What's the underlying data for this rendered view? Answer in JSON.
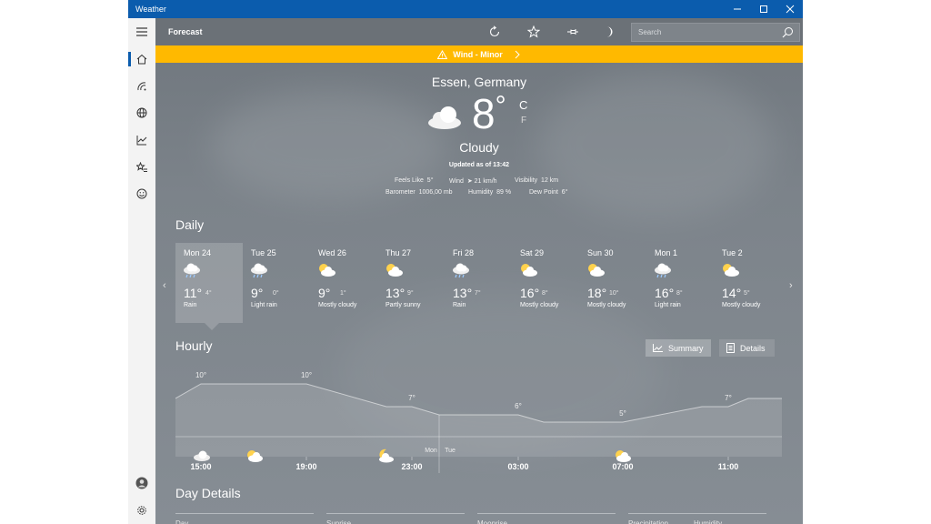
{
  "window": {
    "title": "Weather"
  },
  "appbar": {
    "title": "Forecast",
    "search_placeholder": "Search"
  },
  "alert": {
    "text": "Wind - Minor"
  },
  "current": {
    "location": "Essen, Germany",
    "temperature": "8",
    "degree": "°",
    "unit_c": "C",
    "unit_f": "F",
    "condition": "Cloudy",
    "updated": "Updated as of 13:42",
    "feels_like_label": "Feels Like",
    "feels_like": "5°",
    "wind_label": "Wind",
    "wind": "➤ 21 km/h",
    "visibility_label": "Visibility",
    "visibility": "12 km",
    "barometer_label": "Barometer",
    "barometer": "1006,00 mb",
    "humidity_label": "Humidity",
    "humidity": "89 %",
    "dewpoint_label": "Dew Point",
    "dewpoint": "6°"
  },
  "daily": {
    "title": "Daily",
    "days": [
      {
        "name": "Mon 24",
        "hi": "11°",
        "lo": "4°",
        "desc": "Rain",
        "icon": "rain-cloud-icon"
      },
      {
        "name": "Tue 25",
        "hi": "9°",
        "lo": "0°",
        "desc": "Light rain",
        "icon": "rain-cloud-icon"
      },
      {
        "name": "Wed 26",
        "hi": "9°",
        "lo": "1°",
        "desc": "Mostly cloudy",
        "icon": "partly-sunny-icon"
      },
      {
        "name": "Thu 27",
        "hi": "13°",
        "lo": "9°",
        "desc": "Partly sunny",
        "icon": "partly-sunny-icon"
      },
      {
        "name": "Fri 28",
        "hi": "13°",
        "lo": "7°",
        "desc": "Rain",
        "icon": "rain-cloud-icon"
      },
      {
        "name": "Sat 29",
        "hi": "16°",
        "lo": "8°",
        "desc": "Mostly cloudy",
        "icon": "partly-sunny-icon"
      },
      {
        "name": "Sun 30",
        "hi": "18°",
        "lo": "10°",
        "desc": "Mostly cloudy",
        "icon": "partly-sunny-icon"
      },
      {
        "name": "Mon 1",
        "hi": "16°",
        "lo": "8°",
        "desc": "Light rain",
        "icon": "rain-cloud-icon"
      },
      {
        "name": "Tue 2",
        "hi": "14°",
        "lo": "5°",
        "desc": "Mostly cloudy",
        "icon": "partly-sunny-icon"
      }
    ]
  },
  "hourly": {
    "title": "Hourly",
    "summary_label": "Summary",
    "details_label": "Details",
    "day_divider_left": "Mon",
    "day_divider_right": "Tue",
    "times": [
      "15:00",
      "19:00",
      "23:00",
      "03:00",
      "07:00",
      "11:00"
    ],
    "temp_labels": [
      "10°",
      "10°",
      "7°",
      "6°",
      "5°",
      "7°"
    ]
  },
  "day_details": {
    "title": "Day Details",
    "labels": [
      "Day",
      "Sunrise",
      "Moonrise",
      "Precipitation",
      "Humidity"
    ]
  },
  "colors": {
    "accent": "#0b5cad",
    "alert": "#ffb900"
  }
}
